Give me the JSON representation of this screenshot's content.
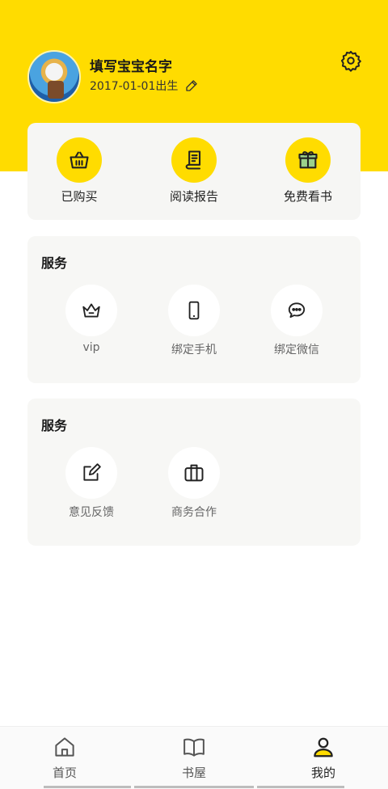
{
  "profile": {
    "name": "填写宝宝名字",
    "birth": "2017-01-01出生"
  },
  "quick_actions": [
    {
      "label": "已购买",
      "icon": "basket-icon"
    },
    {
      "label": "阅读报告",
      "icon": "report-icon"
    },
    {
      "label": "免费看书",
      "icon": "gift-icon"
    }
  ],
  "services_1": {
    "title": "服务",
    "items": [
      {
        "label": "vip",
        "icon": "crown-icon"
      },
      {
        "label": "绑定手机",
        "icon": "phone-icon"
      },
      {
        "label": "绑定微信",
        "icon": "wechat-icon"
      }
    ]
  },
  "services_2": {
    "title": "服务",
    "items": [
      {
        "label": "意见反馈",
        "icon": "feedback-edit-icon"
      },
      {
        "label": "商务合作",
        "icon": "briefcase-icon"
      }
    ]
  },
  "tabbar": [
    {
      "label": "首页",
      "icon": "home-icon",
      "active": false
    },
    {
      "label": "书屋",
      "icon": "book-icon",
      "active": false
    },
    {
      "label": "我的",
      "icon": "user-icon",
      "active": true
    }
  ],
  "colors": {
    "accent": "#FFDC00",
    "card": "#F7F7F5"
  }
}
